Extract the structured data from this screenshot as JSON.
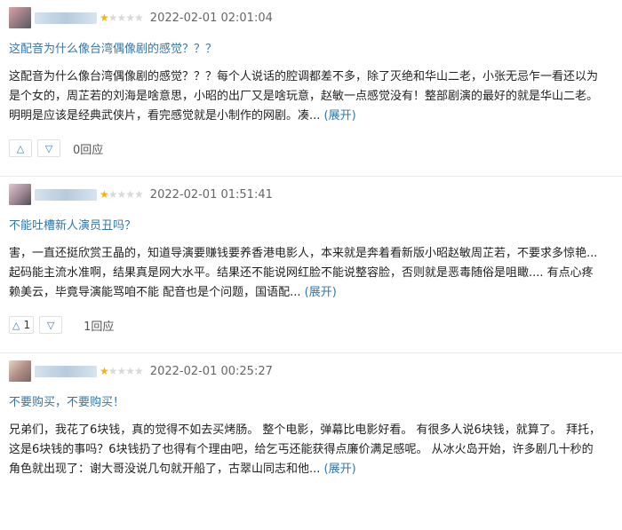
{
  "reviews": [
    {
      "time": "2022-02-01 02:01:04",
      "stars": 1,
      "title": "这配音为什么像台湾偶像剧的感觉？？？",
      "body": "这配音为什么像台湾偶像剧的感觉？？？每个人说话的腔调都差不多，除了灭绝和华山二老，小张无忌乍一看还以为是个女的，周芷若的刘海是啥意思，小昭的出厂又是啥玩意，赵敏一点感觉没有！整部剧演的最好的就是华山二老。明明是应该是经典武侠片，看完感觉就是小制作的网剧。凑...",
      "expand": "(展开)",
      "up_icon": "△",
      "up_count": "",
      "down_icon": "▽",
      "reply": "0回应"
    },
    {
      "time": "2022-02-01 01:51:41",
      "stars": 1,
      "title": "不能吐槽新人演员丑吗？",
      "body": "害，一直还挺欣赏王晶的，知道导演要赚钱要养香港电影人，本来就是奔着看新版小昭赵敏周芷若，不要求多惊艳...起码能主流水准啊，结果真是网大水平。结果还不能说网红脸不能说整容脸，否则就是恶毒随俗是咀瞰.... 有点心疼赖美云，毕竟导演能骂咱不能 配音也是个问题，国语配...",
      "expand": "(展开)",
      "up_icon": "△",
      "up_count": "1",
      "down_icon": "▽",
      "reply": "1回应"
    },
    {
      "time": "2022-02-01 00:25:27",
      "stars": 1,
      "title": "不要购买，不要购买！",
      "body": "兄弟们，我花了6块钱，真的觉得不如去买烤肠。 整个电影，弹幕比电影好看。 有很多人说6块钱，就算了。 拜托，这是6块钱的事吗？6块钱扔了也得有个理由吧，给乞丐还能获得点廉价满足感呢。 从冰火岛开始，许多剧几十秒的角色就出现了：谢大哥没说几句就开船了，古翠山同志和他...",
      "expand": "(展开)"
    }
  ]
}
